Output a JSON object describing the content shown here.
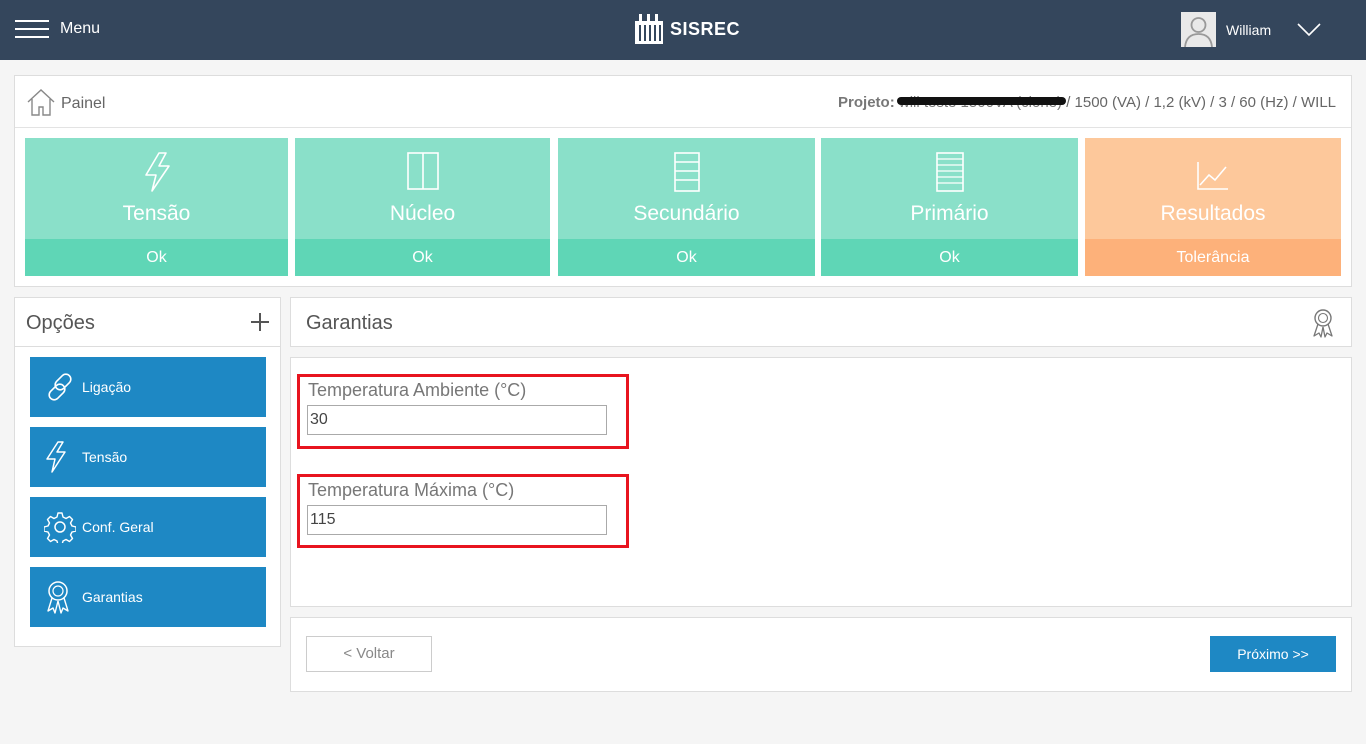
{
  "header": {
    "menu_label": "Menu",
    "brand": "SISREC",
    "user_name": "William"
  },
  "breadcrumb": {
    "label": "Painel"
  },
  "project": {
    "label": "Projeto:",
    "redacted_name": "will teste 1500VA (clone)",
    "details": "/ 1500 (VA) / 1,2 (kV) / 3 / 60 (Hz) / WILL"
  },
  "steps": [
    {
      "title": "Tensão",
      "status": "Ok",
      "icon": "lightning-icon"
    },
    {
      "title": "Núcleo",
      "status": "Ok",
      "icon": "core-icon"
    },
    {
      "title": "Secundário",
      "status": "Ok",
      "icon": "coil-icon"
    },
    {
      "title": "Primário",
      "status": "Ok",
      "icon": "coil-icon"
    },
    {
      "title": "Resultados",
      "status": "Tolerância",
      "icon": "chart-line-icon"
    }
  ],
  "options": {
    "title": "Opções",
    "items": [
      {
        "label": "Ligação",
        "icon": "link-icon"
      },
      {
        "label": "Tensão",
        "icon": "lightning-icon"
      },
      {
        "label": "Conf. Geral",
        "icon": "gear-icon"
      },
      {
        "label": "Garantias",
        "icon": "award-ribbon-icon"
      }
    ]
  },
  "section": {
    "title": "Garantias",
    "icon": "award-ribbon-icon"
  },
  "form": {
    "ambient": {
      "label": "Temperatura Ambiente (°C)",
      "value": "30"
    },
    "max": {
      "label": "Temperatura Máxima (°C)",
      "value": "115"
    }
  },
  "footer": {
    "back_label": "< Voltar",
    "next_label": "Próximo >>"
  },
  "colors": {
    "topbar": "#34465c",
    "step_green": "#8ae0c9",
    "step_green_status": "#5fd6b6",
    "step_orange": "#fdc89b",
    "step_orange_status": "#fdb17a",
    "primary_button": "#1e88c4",
    "highlight_border": "#e8141f"
  }
}
